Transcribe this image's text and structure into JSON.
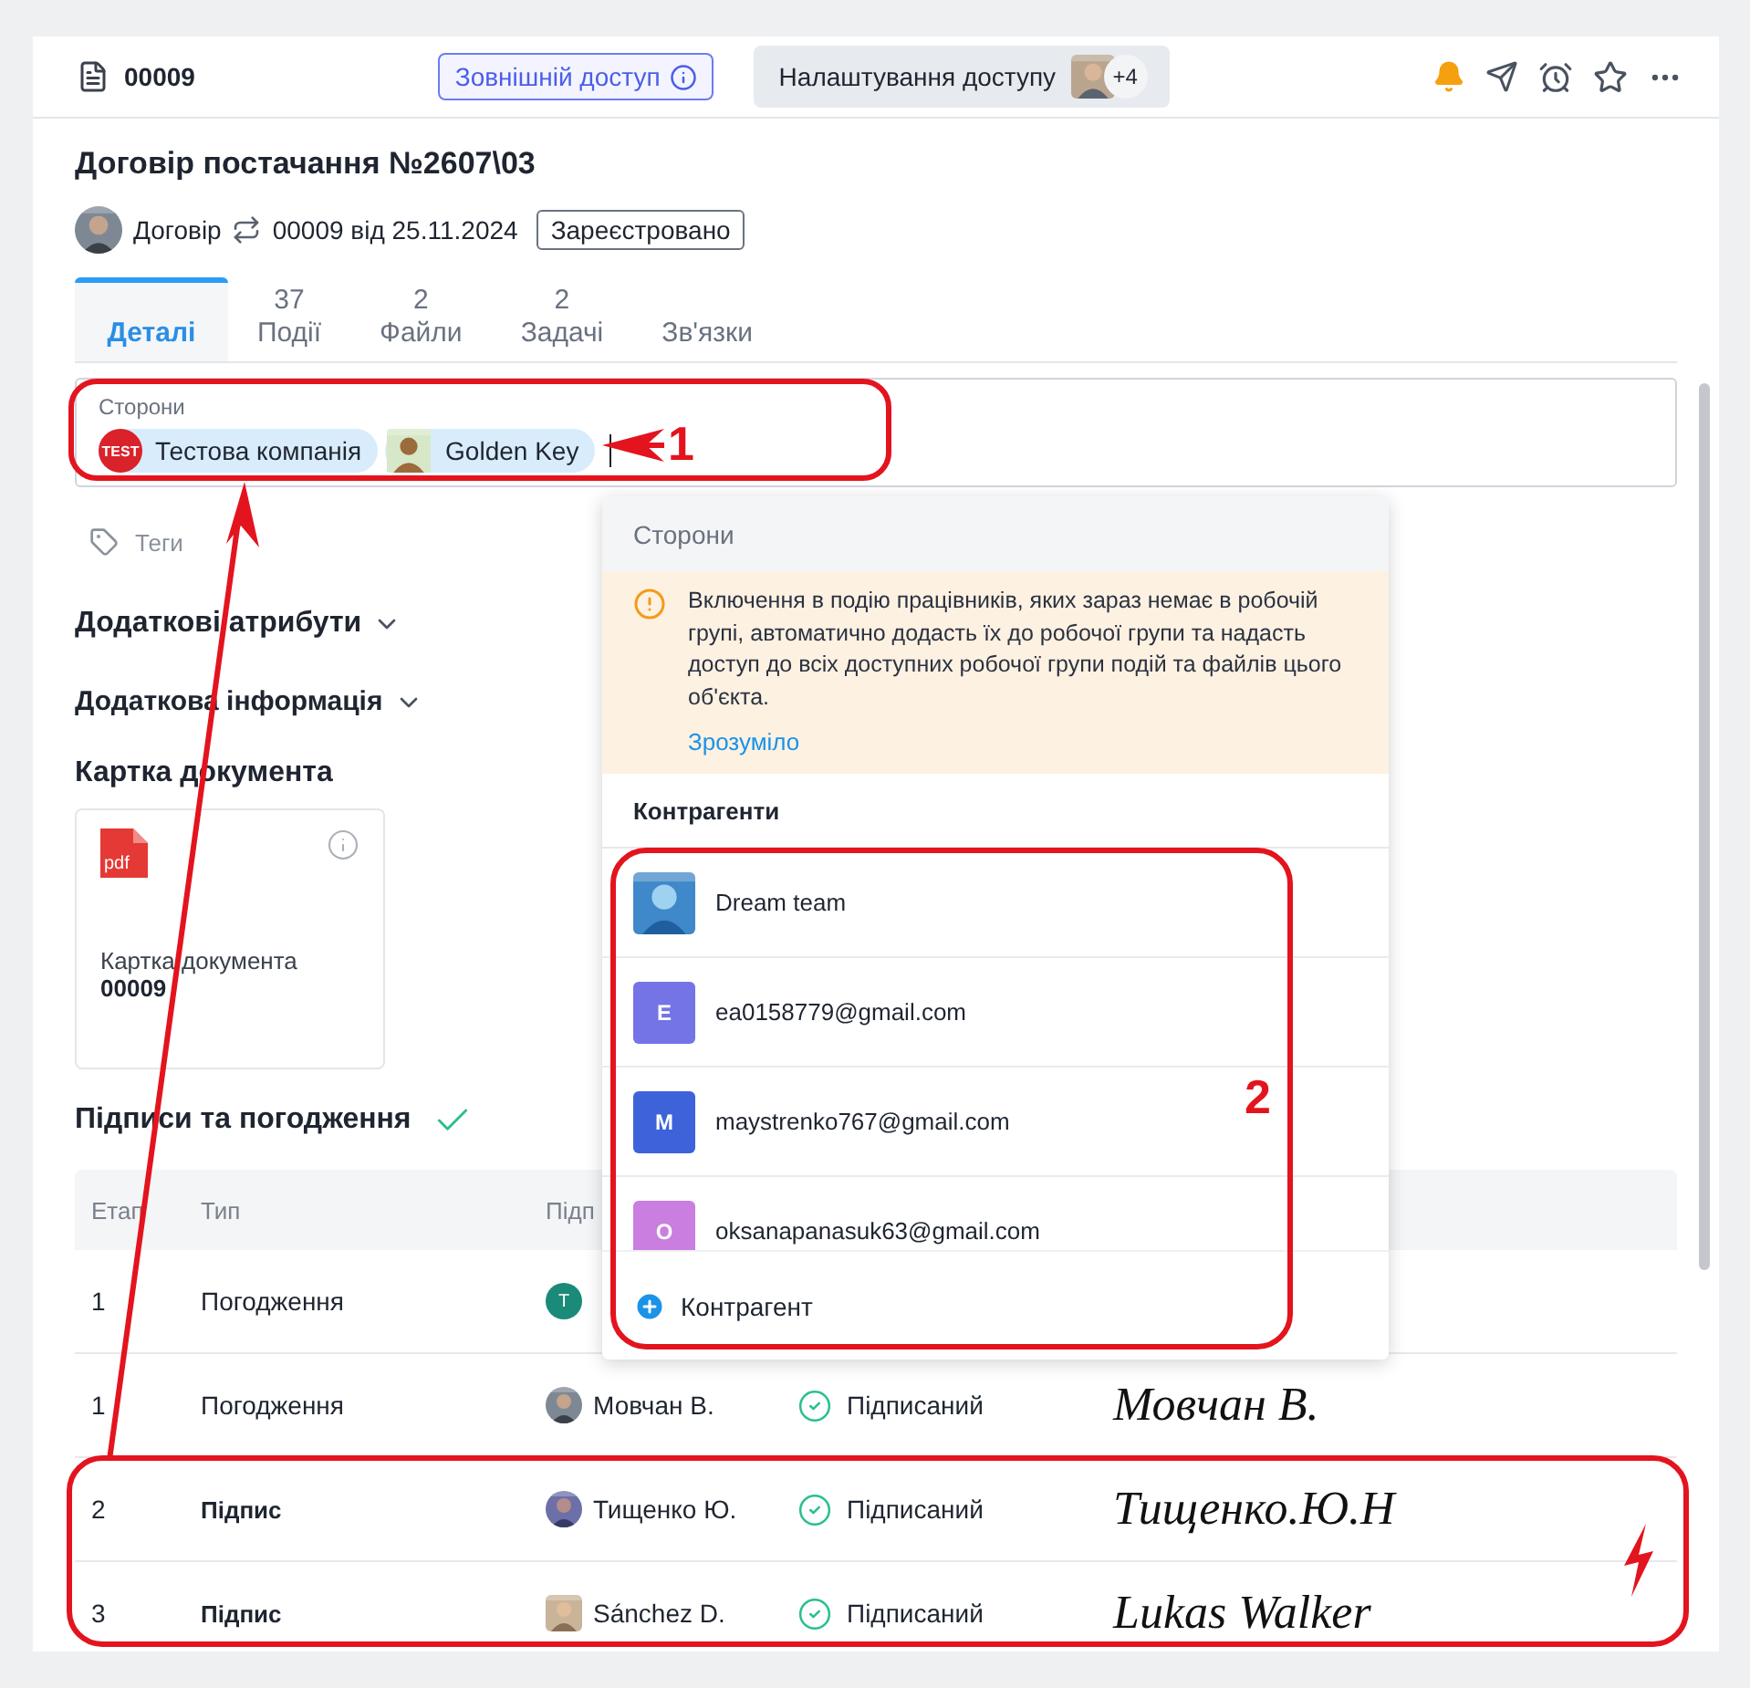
{
  "header": {
    "doc_number": "00009",
    "external_access": "Зовнішній доступ",
    "access_settings": "Налаштування доступу",
    "access_extra": "+4"
  },
  "title": "Договір постачання №2607\\03",
  "meta": {
    "type": "Договір",
    "number": "00009 від 25.11.2024",
    "status": "Зареєстровано"
  },
  "tabs": [
    {
      "label": "Деталі",
      "selected": true
    },
    {
      "count": "37",
      "label": "Події",
      "selected": false
    },
    {
      "count": "2",
      "label": "Файли",
      "selected": false
    },
    {
      "count": "2",
      "label": "Задачі",
      "selected": false
    },
    {
      "label": "Зв'язки",
      "selected": false
    }
  ],
  "parties": {
    "label": "Сторони",
    "chips": [
      {
        "kind": "logo",
        "logo_text": "TEST",
        "name": "Тестова компанія"
      },
      {
        "kind": "picture",
        "name": "Golden Key"
      }
    ]
  },
  "tags": "Теги",
  "sections": [
    "Додаткові атрибути",
    "Додаткова інформація"
  ],
  "card": {
    "heading": "Картка документа",
    "file_type": "pdf",
    "name": "Картка документа",
    "number": "00009"
  },
  "signatures": {
    "heading": "Підписи та погодження",
    "columns": [
      "Етап",
      "Тип",
      "Підп"
    ],
    "rows": [
      {
        "stage": "1",
        "type": "Погодження",
        "emphasized": false,
        "avatar": {
          "kind": "letter",
          "letter": "Т",
          "color": "#1b8a78"
        }
      },
      {
        "stage": "1",
        "type": "Погодження",
        "emphasized": false,
        "signer": "Мовчан В.",
        "status": "Підписаний",
        "signature": "Мовчан В."
      },
      {
        "stage": "2",
        "type": "Підпис",
        "emphasized": true,
        "signer": "Тищенко Ю.",
        "status": "Підписаний",
        "signature": "Тищенко.Ю.Н"
      },
      {
        "stage": "3",
        "type": "Підпис",
        "emphasized": true,
        "signer": "Sánchez D.",
        "status": "Підписаний",
        "signature": "Lukas Walker"
      }
    ]
  },
  "popup": {
    "title": "Сторони",
    "notice": "Включення в подію працівників, яких зараз немає в робочій групі, автоматично додасть їх до робочої групи та надасть доступ до всіх доступних робочої групи подій та файлів цього об'єкта.",
    "notice_action": "Зрозуміло",
    "section": "Контрагенти",
    "items": [
      {
        "kind": "picture",
        "name": "Dream team"
      },
      {
        "kind": "letter",
        "letter": "E",
        "color": "#7474e6",
        "name": "ea0158779@gmail.com"
      },
      {
        "kind": "letter",
        "letter": "M",
        "color": "#3d62da",
        "name": "maystrenko767@gmail.com"
      },
      {
        "kind": "letter",
        "letter": "O",
        "color": "#c97ee0",
        "name": "oksanapanasuk63@gmail.com"
      }
    ],
    "add": "Контрагент"
  },
  "annotations": [
    {
      "label": "1"
    },
    {
      "label": "2"
    }
  ]
}
